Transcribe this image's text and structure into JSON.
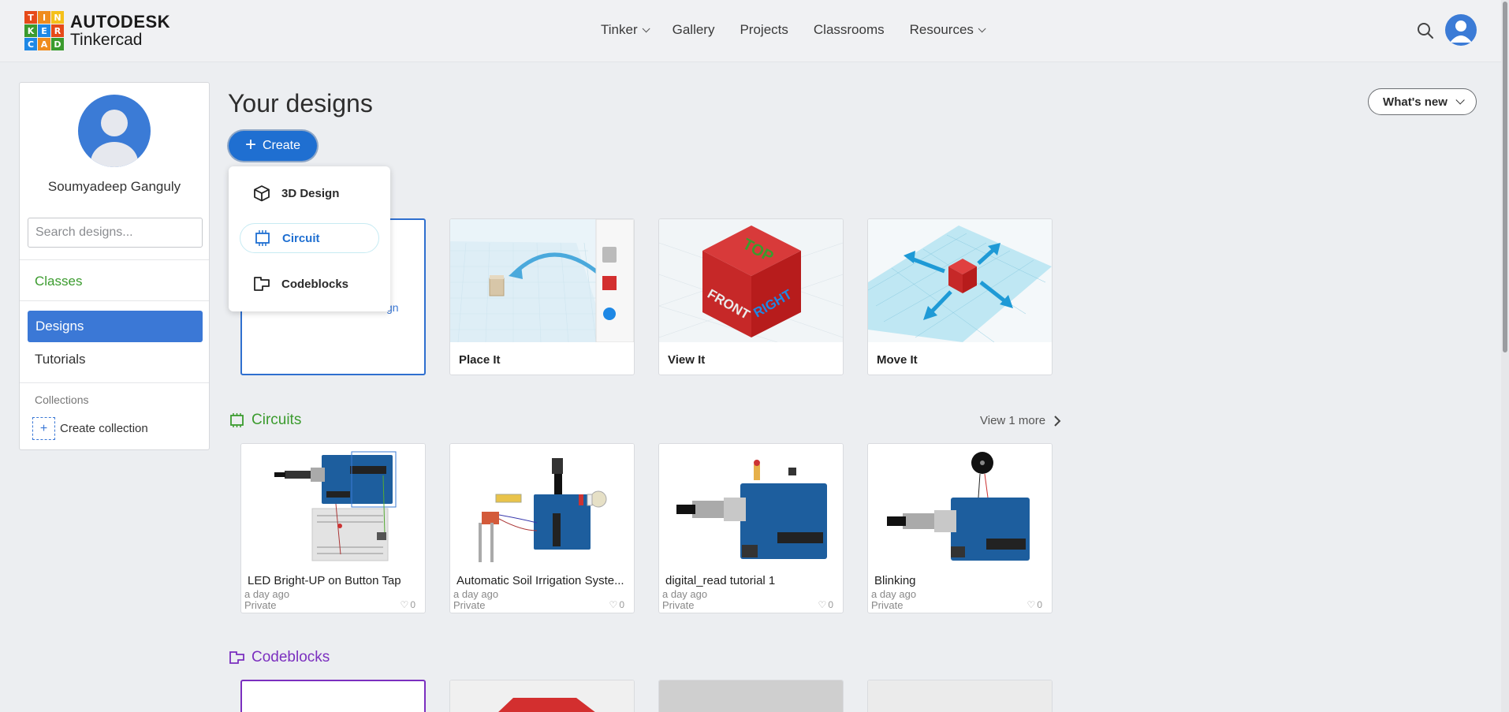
{
  "brand": {
    "logo_letters": [
      "T",
      "I",
      "N",
      "K",
      "E",
      "R",
      "C",
      "A",
      "D"
    ],
    "logo_colors": [
      "#e64a19",
      "#ef8c1d",
      "#f5c01a",
      "#3b9b2e",
      "#1e88e5",
      "#e64a19",
      "#1e88e5",
      "#ef8c1d",
      "#3b9b2e"
    ],
    "company": "AUTODESK",
    "product": "Tinkercad"
  },
  "nav": {
    "items": [
      {
        "label": "Tinker",
        "has_dropdown": true
      },
      {
        "label": "Gallery",
        "has_dropdown": false
      },
      {
        "label": "Projects",
        "has_dropdown": false
      },
      {
        "label": "Classrooms",
        "has_dropdown": false
      },
      {
        "label": "Resources",
        "has_dropdown": true
      }
    ],
    "search_icon": "search-icon",
    "avatar_icon": "user-avatar-icon"
  },
  "sidebar": {
    "user_name": "Soumyadeep Ganguly",
    "search_placeholder": "Search designs...",
    "classes_label": "Classes",
    "designs_label": "Designs",
    "tutorials_label": "Tutorials",
    "collections_label": "Collections",
    "create_collection_label": "Create collection"
  },
  "main": {
    "title": "Your designs",
    "create_label": "Create",
    "whats_new_label": "What's new",
    "create_menu": [
      {
        "label": "3D Design",
        "icon": "cube-icon",
        "active": false
      },
      {
        "label": "Circuit",
        "icon": "circuit-chip-icon",
        "active": true
      },
      {
        "label": "Codeblocks",
        "icon": "codeblocks-icon",
        "active": false
      }
    ],
    "partial_card_text": "gn",
    "lessons": [
      {
        "title": "Place It"
      },
      {
        "title": "View It",
        "cube_labels": [
          "TOP",
          "FRONT",
          "RIGHT"
        ]
      },
      {
        "title": "Move It"
      }
    ],
    "circuits_section": {
      "label": "Circuits",
      "view_more": "View 1 more",
      "items": [
        {
          "title": "LED Bright-UP on Button Tap",
          "time": "a day ago",
          "privacy": "Private",
          "likes": "0"
        },
        {
          "title": "Automatic Soil Irrigation Syste...",
          "time": "a day ago",
          "privacy": "Private",
          "likes": "0"
        },
        {
          "title": "digital_read tutorial 1",
          "time": "a day ago",
          "privacy": "Private",
          "likes": "0"
        },
        {
          "title": "Blinking",
          "time": "a day ago",
          "privacy": "Private",
          "likes": "0"
        }
      ]
    },
    "codeblocks_section": {
      "label": "Codeblocks"
    }
  },
  "colors": {
    "accent_blue": "#1f6fd1",
    "sidebar_active": "#3b78d6",
    "circuits_green": "#3b9b2e",
    "codeblocks_purple": "#7b2fbf"
  }
}
